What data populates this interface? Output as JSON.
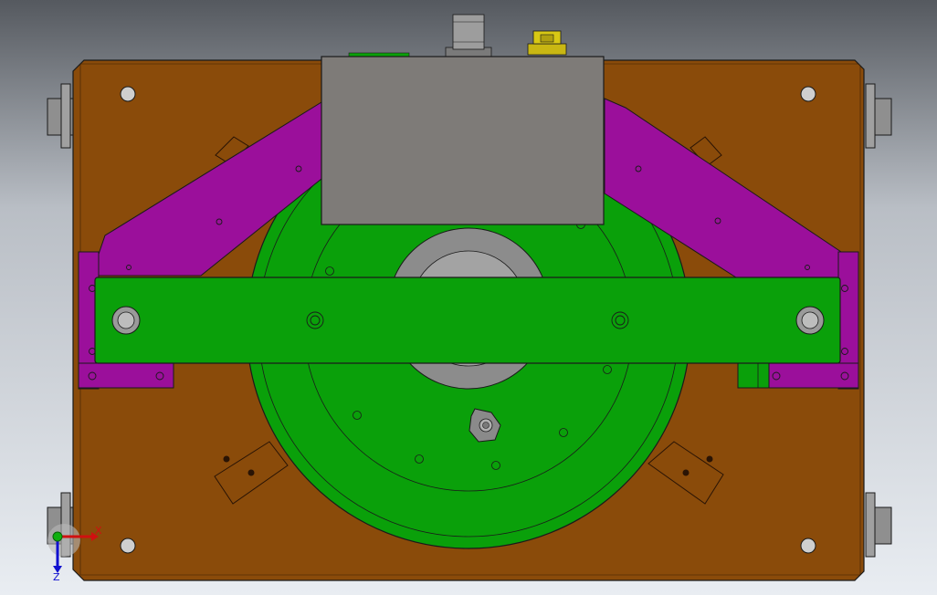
{
  "viewport": {
    "background_top": "#55595f",
    "background_bottom": "#e9edf2"
  },
  "colors": {
    "plate": "#8a4b0a",
    "frame": "#7f7f7f",
    "arm": "#9b0f9b",
    "disc": "#0aa00a",
    "hub": "#8c8c8c",
    "housing": "#7e7b78",
    "connector_gold": "#d8c814",
    "outline": "#1a1a1a"
  },
  "triad": {
    "x_label": "X",
    "z_label": "Z",
    "x_color": "#d01010",
    "y_color": "#10b010",
    "z_color": "#1010d0"
  }
}
